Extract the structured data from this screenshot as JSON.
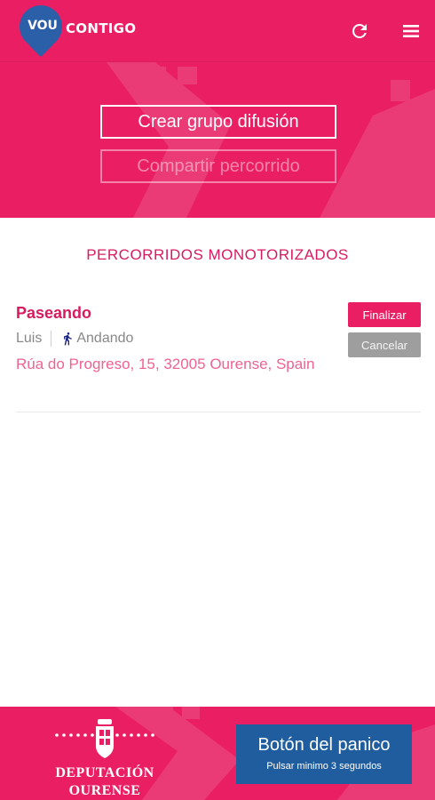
{
  "app": {
    "logo_badge": "VOU",
    "logo_text": "CONTIGO",
    "colors": {
      "primary": "#e91e63",
      "accent_blue": "#1f5d9e",
      "muted": "#9e9e9e"
    },
    "icons": {
      "refresh": "refresh-icon",
      "menu": "menu-icon"
    }
  },
  "hero": {
    "create_group_label": "Crear grupo difusión",
    "share_route_label": "Compartir percorrido"
  },
  "routes": {
    "title": "PERCORRIDOS MONOTORIZADOS",
    "items": [
      {
        "name": "Paseando",
        "user": "Luis",
        "mode": "Andando",
        "mode_icon": "walking-icon",
        "address": "Rúa do Progreso, 15, 32005 Ourense, Spain",
        "finish_label": "Finalizar",
        "cancel_label": "Cancelar"
      }
    ]
  },
  "footer": {
    "dept_line1": "DEPUTACIÓN",
    "dept_line2": "OURENSE",
    "panic_title": "Botón del panico",
    "panic_subtitle": "Pulsar minimo 3 segundos"
  }
}
